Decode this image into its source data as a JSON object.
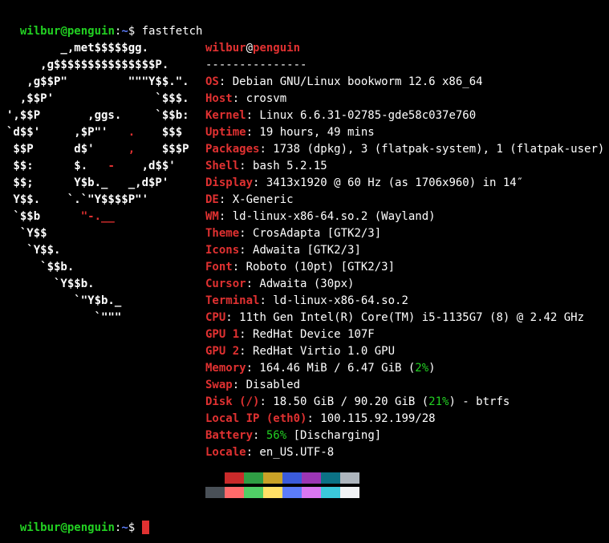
{
  "prompt": {
    "user": "wilbur",
    "at": "@",
    "host": "penguin",
    "colon": ":",
    "path": "~",
    "dollar": "$ "
  },
  "cmd": "fastfetch",
  "logo": [
    "        _,met$$$$$gg.",
    "     ,g$$$$$$$$$$$$$$$P.",
    "   ,g$$P\"         \"\"\"Y$$.\".",
    "  ,$$P'               `$$$.",
    "',$$P       ,ggs.     `$$b:",
    "`d$$'     ,$P\"'   .    $$$ ",
    " $$P      d$'     ,    $$$P",
    " $$:      $.   -    ,d$$'",
    " $$;      Y$b._   _,d$P'",
    " Y$$.    `.`\"Y$$$$P\"'",
    " `$$b      \"-.__",
    "  `Y$$",
    "   `Y$$.",
    "     `$$b.",
    "       `Y$$b.",
    "          `\"Y$b._",
    "             `\"\"\""
  ],
  "title": {
    "user": "wilbur",
    "at": "@",
    "host": "penguin"
  },
  "separator": "---------------",
  "info": [
    {
      "label": "OS",
      "val": ": Debian GNU/Linux bookworm 12.6 x86_64"
    },
    {
      "label": "Host",
      "val": ": crosvm"
    },
    {
      "label": "Kernel",
      "val": ": Linux 6.6.31-02785-gde58c037e760"
    },
    {
      "label": "Uptime",
      "val": ": 19 hours, 49 mins"
    },
    {
      "label": "Packages",
      "val": ": 1738 (dpkg), 3 (flatpak-system), 1 (flatpak-user)"
    },
    {
      "label": "Shell",
      "val": ": bash 5.2.15"
    },
    {
      "label": "Display",
      "val": ": 3413x1920 @ 60 Hz (as 1706x960) in 14″"
    },
    {
      "label": "DE",
      "val": ": X-Generic"
    },
    {
      "label": "WM",
      "val": ": ld-linux-x86-64.so.2 (Wayland)"
    },
    {
      "label": "Theme",
      "val": ": CrosAdapta [GTK2/3]"
    },
    {
      "label": "Icons",
      "val": ": Adwaita [GTK2/3]"
    },
    {
      "label": "Font",
      "val": ": Roboto (10pt) [GTK2/3]"
    },
    {
      "label": "Cursor",
      "val": ": Adwaita (30px)"
    },
    {
      "label": "Terminal",
      "val": ": ld-linux-x86-64.so.2"
    },
    {
      "label": "CPU",
      "val": ": 11th Gen Intel(R) Core(TM) i5-1135G7 (8) @ 2.42 GHz"
    },
    {
      "label": "GPU 1",
      "val": ": RedHat Device 107F"
    },
    {
      "label": "GPU 2",
      "val": ": RedHat Virtio 1.0 GPU"
    }
  ],
  "memory": {
    "label": "Memory",
    "pre": ": 164.46 MiB / 6.47 GiB (",
    "pct": "2%",
    "post": ")"
  },
  "swap": {
    "label": "Swap",
    "val": ": Disabled"
  },
  "disk": {
    "label": "Disk (/)",
    "pre": ": 18.50 GiB / 90.20 GiB (",
    "pct": "21%",
    "post": ") - btrfs"
  },
  "ip": {
    "label": "Local IP (eth0)",
    "val": ": 100.115.92.199/28"
  },
  "battery": {
    "label": "Battery",
    "pre": ": ",
    "pct": "56%",
    "post": " [Discharging]"
  },
  "locale": {
    "label": "Locale",
    "val": ": en_US.UTF-8"
  },
  "swatch1": [
    "#000000",
    "#c92a2a",
    "#2f9e44",
    "#c9a227",
    "#3b5bdb",
    "#9c36b5",
    "#0b7285",
    "#adb5bd"
  ],
  "swatch2": [
    "#495057",
    "#ff6b6b",
    "#51cf66",
    "#ffe066",
    "#5c7cfa",
    "#da77f2",
    "#3bc9db",
    "#f1f3f5"
  ]
}
